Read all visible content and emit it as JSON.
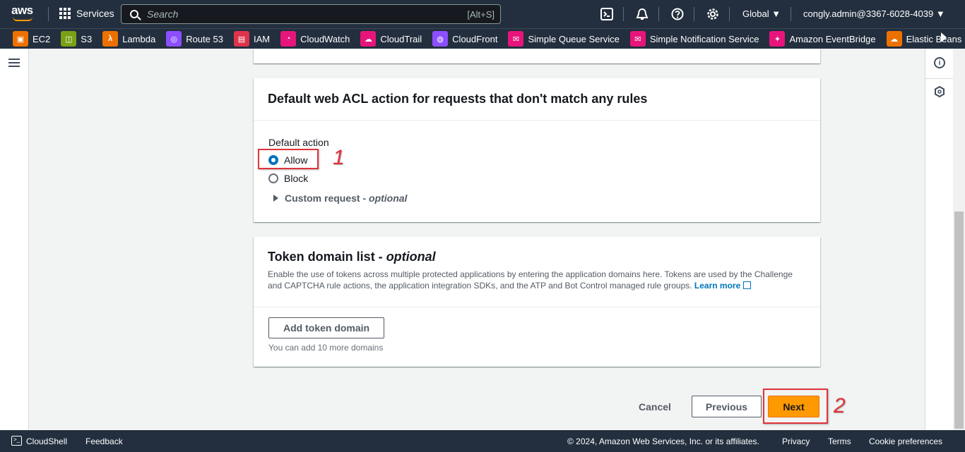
{
  "topnav": {
    "logo_text": "aws",
    "services_label": "Services",
    "search_placeholder": "Search",
    "search_shortcut": "[Alt+S]",
    "region": "Global ▼",
    "account": "congly.admin@3367-6028-4039 ▼"
  },
  "favorites": [
    {
      "label": "EC2",
      "color": "#ed7100",
      "glyph": "▣"
    },
    {
      "label": "S3",
      "color": "#7aa116",
      "glyph": "◫"
    },
    {
      "label": "Lambda",
      "color": "#ed7100",
      "glyph": "λ"
    },
    {
      "label": "Route 53",
      "color": "#8c4fff",
      "glyph": "◎"
    },
    {
      "label": "IAM",
      "color": "#dd344c",
      "glyph": "▤"
    },
    {
      "label": "CloudWatch",
      "color": "#e7157b",
      "glyph": "◔"
    },
    {
      "label": "CloudTrail",
      "color": "#e7157b",
      "glyph": "☁"
    },
    {
      "label": "CloudFront",
      "color": "#8c4fff",
      "glyph": "◍"
    },
    {
      "label": "Simple Queue Service",
      "color": "#e7157b",
      "glyph": "✉"
    },
    {
      "label": "Simple Notification Service",
      "color": "#e7157b",
      "glyph": "✉"
    },
    {
      "label": "Amazon EventBridge",
      "color": "#e7157b",
      "glyph": "✦"
    },
    {
      "label": "Elastic Beans",
      "color": "#ed7100",
      "glyph": "☁"
    }
  ],
  "acl_panel": {
    "title": "Default web ACL action for requests that don't match any rules",
    "field_label": "Default action",
    "option_allow": "Allow",
    "option_block": "Block",
    "expander_label": "Custom request - ",
    "expander_optional": "optional",
    "selected": "Allow"
  },
  "token_panel": {
    "title": "Token domain list - ",
    "title_optional": "optional",
    "description": "Enable the use of tokens across multiple protected applications by entering the application domains here. Tokens are used by the Challenge and CAPTCHA rule actions, the application integration SDKs, and the ATP and Bot Control managed rule groups. ",
    "learn_more": "Learn more",
    "add_button": "Add token domain",
    "constraint": "You can add 10 more domains"
  },
  "actions": {
    "cancel": "Cancel",
    "previous": "Previous",
    "next": "Next"
  },
  "annotations": {
    "step1": "1",
    "step2": "2"
  },
  "bottombar": {
    "cloudshell_icon": ">_",
    "cloudshell": "CloudShell",
    "feedback": "Feedback",
    "copyright": "© 2024, Amazon Web Services, Inc. or its affiliates.",
    "privacy": "Privacy",
    "terms": "Terms",
    "cookies": "Cookie preferences"
  },
  "colors": {
    "nav_bg": "#232f3e",
    "accent": "#ff9900",
    "link": "#0073bb",
    "annotation": "#e0333a"
  }
}
